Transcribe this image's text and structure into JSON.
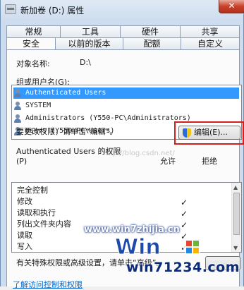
{
  "window": {
    "title": "新加卷 (D:) 属性",
    "close_glyph": "✕"
  },
  "tabs": {
    "row1": [
      "常规",
      "工具",
      "硬件",
      "共享"
    ],
    "row2": [
      "安全",
      "以前的版本",
      "配额",
      "自定义"
    ],
    "active": "安全"
  },
  "object": {
    "label": "对象名称:",
    "value": "D:\\"
  },
  "groups": {
    "label": "组或用户名(G):",
    "items": [
      "Authenticated Users",
      "SYSTEM",
      "Administrators (Y550-PC\\Administrators)",
      "Users (Y550-PC\\Users)"
    ],
    "selected_index": 0
  },
  "edit": {
    "hint": "要更改权限，请单击“编辑”。",
    "button_label": "编辑(E)..."
  },
  "permissions": {
    "title": "Authenticated Users 的权限",
    "p_label": "(P)",
    "col_allow": "允许",
    "col_deny": "拒绝",
    "rows": [
      {
        "name": "完全控制",
        "allow": false
      },
      {
        "name": "修改",
        "allow": true
      },
      {
        "name": "读取和执行",
        "allow": true
      },
      {
        "name": "列出文件夹内容",
        "allow": true
      },
      {
        "name": "读取",
        "allow": true
      },
      {
        "name": "写入",
        "allow": true
      }
    ],
    "check_glyph": "✓"
  },
  "advanced": {
    "hint": "有关特殊权限或高级设置，请单击“高级”。"
  },
  "link": {
    "text": "了解访问控制和权限"
  },
  "watermarks": {
    "blog": "http://blog.csdn.net/",
    "site1": "www.win7zhijia.cn",
    "site2": "win71234.com"
  },
  "colors": {
    "selection": "#3399ff",
    "highlight_border": "#d41f1f"
  }
}
